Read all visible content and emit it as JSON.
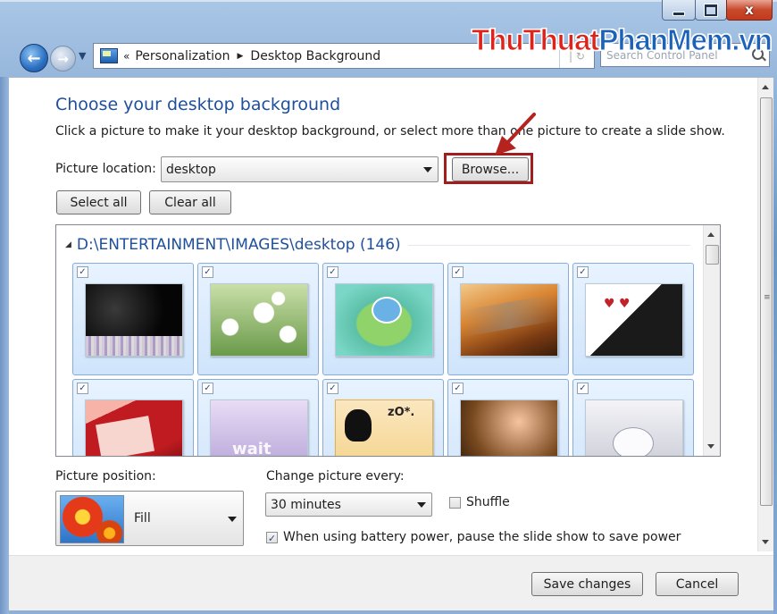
{
  "window": {
    "caption_close_glyph": "x"
  },
  "nav": {
    "breadcrumb_sep": "«",
    "crumb1": "Personalization",
    "crumb_arrow": "▶",
    "crumb2": "Desktop Background",
    "refresh_glyph": "| ↻",
    "search_placeholder": "Search Control Panel"
  },
  "watermark": {
    "part1": "Thu",
    "part2": "Thuat",
    "part3": "PhanMem",
    "part4": ".vn"
  },
  "page": {
    "title": "Choose your desktop background",
    "subtitle": "Click a picture to make it your desktop background, or select more than one picture to create a slide show.",
    "picture_location_label": "Picture location:",
    "picture_location_value": "desktop",
    "browse_label": "Browse...",
    "select_all_label": "Select all",
    "clear_all_label": "Clear all"
  },
  "gallery": {
    "toggle_glyph": "◢",
    "group_title": "D:\\ENTERTAINMENT\\IMAGES\\desktop (146)",
    "check_glyph": "✓",
    "tiles": [
      {
        "name": "wallpaper-dark-flowers",
        "checked": true
      },
      {
        "name": "wallpaper-daisies",
        "checked": true
      },
      {
        "name": "wallpaper-cartoon-green",
        "checked": true
      },
      {
        "name": "wallpaper-autumn-road",
        "checked": true
      },
      {
        "name": "wallpaper-black-white-hearts",
        "checked": true
      },
      {
        "name": "wallpaper-red-frame",
        "checked": true
      },
      {
        "name": "wallpaper-wait-purple",
        "checked": true
      },
      {
        "name": "wallpaper-cartoon-girl",
        "checked": true
      },
      {
        "name": "wallpaper-wooden-dolls",
        "checked": true
      },
      {
        "name": "wallpaper-snow-cat",
        "checked": true
      }
    ]
  },
  "options": {
    "picture_position_label": "Picture position:",
    "picture_position_value": "Fill",
    "change_every_label": "Change picture every:",
    "change_every_value": "30 minutes",
    "shuffle_label": "Shuffle",
    "shuffle_checked": false,
    "battery_label": "When using battery power, pause the slide show to save power",
    "battery_checked": true
  },
  "footer": {
    "save_label": "Save changes",
    "cancel_label": "Cancel"
  },
  "colors": {
    "title_blue": "#1e4f9c",
    "highlight_red": "#a21d1d",
    "tile_selected": "#cfe4fb"
  }
}
